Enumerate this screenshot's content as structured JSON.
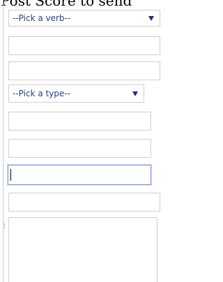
{
  "form": {
    "heading": "Post Score to send",
    "verb_select": {
      "selected": "--Pick a verb--",
      "options": [
        "--Pick a verb--"
      ]
    },
    "type_select": {
      "selected": "--Pick a type--",
      "options": [
        "--Pick a type--"
      ]
    },
    "fields": [
      {
        "value": "",
        "placeholder": ""
      },
      {
        "value": "",
        "placeholder": ""
      },
      {
        "value": "",
        "placeholder": ""
      },
      {
        "value": "",
        "placeholder": ""
      },
      {
        "value": "",
        "placeholder": ""
      },
      {
        "value": "",
        "placeholder": ""
      }
    ],
    "message": {
      "value": ""
    },
    "colors": {
      "select_text": "#2a3e8c",
      "caret": "#1f2f78",
      "focus_border": "#6f8fe0",
      "field_border": "#cfcfcf"
    }
  }
}
